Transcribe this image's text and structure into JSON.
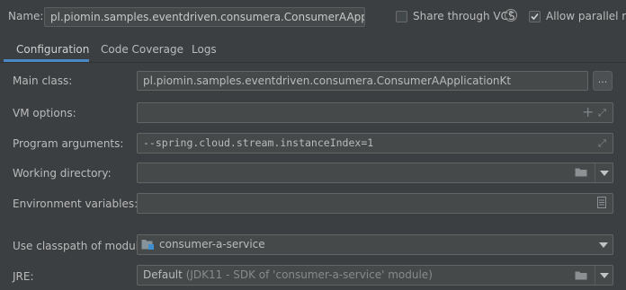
{
  "header": {
    "name_label": "Name:",
    "name_value": "pl.piomin.samples.eventdriven.consumera.ConsumerAApplicationKt",
    "share_vcs_label": "Share through VCS",
    "share_vcs_checked": false,
    "help_icon": "question-circle-icon",
    "allow_parallel_label": "Allow parallel run",
    "allow_parallel_checked": true
  },
  "tabs": [
    {
      "label": "Configuration",
      "active": true
    },
    {
      "label": "Code Coverage",
      "active": false
    },
    {
      "label": "Logs",
      "active": false
    }
  ],
  "form": {
    "main_class_label": "Main class:",
    "main_class_value": "pl.piomin.samples.eventdriven.consumera.ConsumerAApplicationKt",
    "browse_label": "...",
    "vm_options_label": "VM options:",
    "vm_options_value": "",
    "program_args_label": "Program arguments:",
    "program_args_value": "--spring.cloud.stream.instanceIndex=1",
    "working_dir_label": "Working directory:",
    "working_dir_value": "",
    "env_vars_label": "Environment variables:",
    "env_vars_value": "",
    "classpath_label": "Use classpath of module:",
    "classpath_value": "consumer-a-service",
    "jre_label": "JRE:",
    "jre_default": "Default",
    "jre_detail": "(JDK11 - SDK of 'consumer-a-service' module)"
  },
  "colors": {
    "background": "#3c3f41",
    "field": "#45494a",
    "tab_underline": "#4a88c7",
    "text": "#bbbbbb"
  }
}
